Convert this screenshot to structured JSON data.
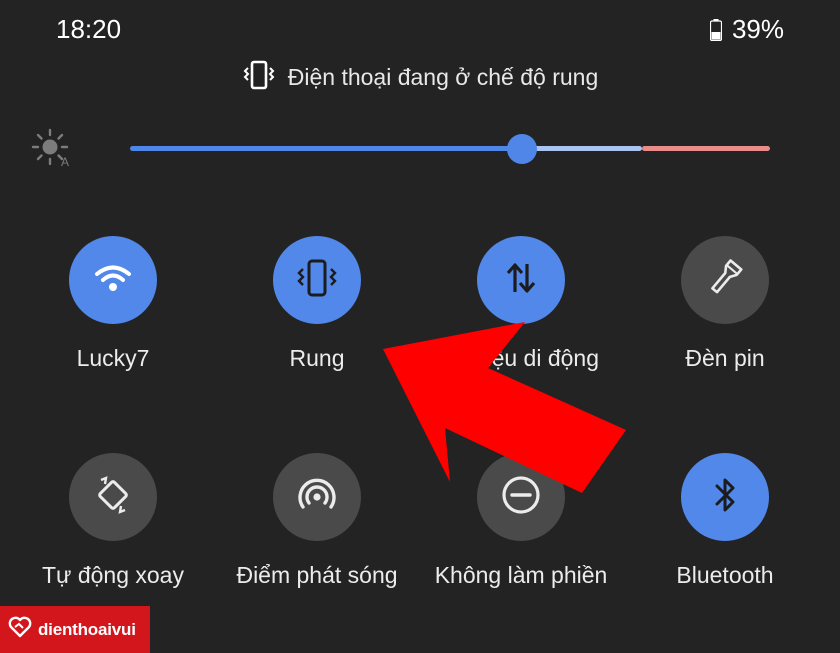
{
  "status_bar": {
    "time": "18:20",
    "battery_percent": "39%",
    "battery_level": 0.39
  },
  "ringer_info": {
    "icon": "vibrate-icon",
    "text": "Điện thoại đang ở chế độ rung"
  },
  "brightness": {
    "icon": "auto-brightness-icon",
    "level": 0.61,
    "colors": {
      "filled": "#4f86e8",
      "track": "#a8c4ef",
      "high": "#e88c8c"
    }
  },
  "tiles": [
    {
      "label": "Lucky7",
      "icon": "wifi-icon",
      "state": "on"
    },
    {
      "label": "Rung",
      "icon": "vibrate-icon",
      "state": "on"
    },
    {
      "label": "Dữ liệu di động",
      "icon": "mobile-data-icon",
      "state": "on"
    },
    {
      "label": "Đèn pin",
      "icon": "flashlight-icon",
      "state": "off"
    },
    {
      "label": "Tự động xoay",
      "icon": "auto-rotate-icon",
      "state": "off"
    },
    {
      "label": "Điểm phát sóng",
      "icon": "hotspot-icon",
      "state": "off"
    },
    {
      "label": "Không làm phiền",
      "icon": "do-not-disturb-icon",
      "state": "off"
    },
    {
      "label": "Bluetooth",
      "icon": "bluetooth-icon",
      "state": "on"
    }
  ],
  "annotation": {
    "arrow_color": "#ff0000",
    "points_to": "Rung"
  },
  "watermark": {
    "text": "dienthoaivui",
    "color": "#d3151c"
  },
  "colors": {
    "background": "#232323",
    "tile_on": "#5188ea",
    "tile_off": "#4a4a4a"
  }
}
